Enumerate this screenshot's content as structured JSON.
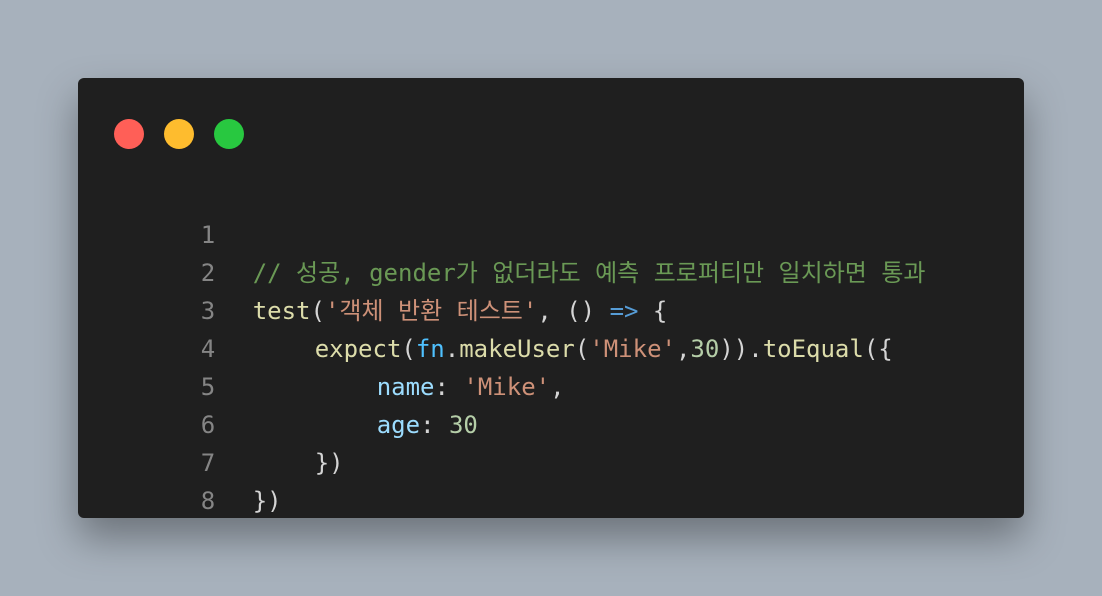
{
  "colors": {
    "background": "#a7b1bc",
    "window": "#1f1f1f",
    "dot_red": "#ff5f57",
    "dot_yellow": "#febc2e",
    "dot_green": "#28c840"
  },
  "code": {
    "line_numbers": [
      "1",
      "2",
      "3",
      "4",
      "5",
      "6",
      "7",
      "8"
    ],
    "line2": {
      "comment": "// 성공, gender가 없더라도 예측 프로퍼티만 일치하면 통과"
    },
    "line3": {
      "func": "test",
      "open_paren": "(",
      "string": "'객체 반환 테스트'",
      "comma_args": ", () ",
      "arrow": "=>",
      "brace": " {"
    },
    "line4": {
      "func": "expect",
      "open_paren": "(",
      "object": "fn",
      "dot": ".",
      "method": "makeUser",
      "open_paren2": "(",
      "string": "'Mike'",
      "comma": ",",
      "number": "30",
      "close": "))",
      "dot2": ".",
      "method2": "toEqual",
      "open_brace": "({"
    },
    "line5": {
      "prop": "name",
      "colon": ": ",
      "string": "'Mike'",
      "comma": ","
    },
    "line6": {
      "prop": "age",
      "colon": ": ",
      "number": "30"
    },
    "line7": {
      "close": "})"
    },
    "line8": {
      "close": "})"
    }
  }
}
